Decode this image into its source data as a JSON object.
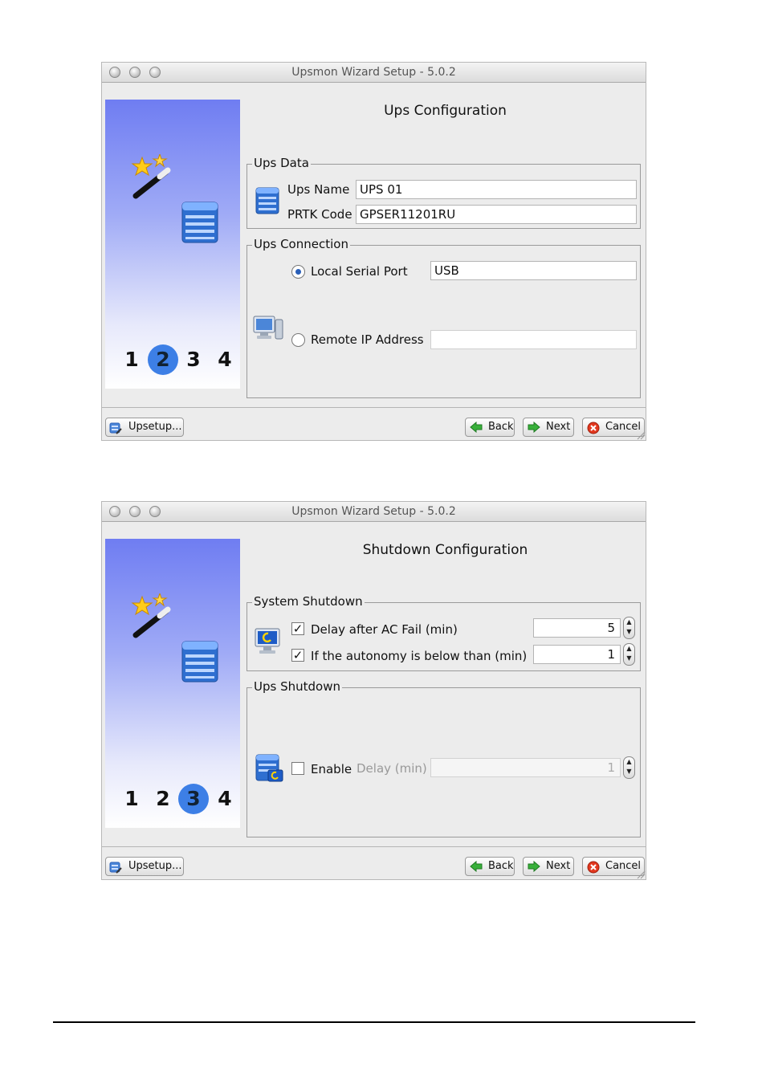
{
  "windows": [
    {
      "title": "Upsmon Wizard Setup - 5.0.2",
      "page_title": "Ups Configuration",
      "steps": [
        "1",
        "2",
        "3",
        "4"
      ],
      "active_step": "2",
      "ups_data": {
        "legend": "Ups Data",
        "name_label": "Ups Name",
        "name_value": "UPS 01",
        "prtk_label": "PRTK Code",
        "prtk_value": "GPSER11201RU"
      },
      "ups_connection": {
        "legend": "Ups Connection",
        "local_label": "Local Serial Port",
        "local_value": "USB",
        "local_selected": true,
        "remote_label": "Remote IP Address",
        "remote_value": "",
        "remote_selected": false
      },
      "buttons": {
        "upsetup": "Upsetup...",
        "back": "Back",
        "next": "Next",
        "cancel": "Cancel"
      }
    },
    {
      "title": "Upsmon Wizard Setup - 5.0.2",
      "page_title": "Shutdown Configuration",
      "steps": [
        "1",
        "2",
        "3",
        "4"
      ],
      "active_step": "3",
      "system_shutdown": {
        "legend": "System Shutdown",
        "delay_label": "Delay after AC Fail (min)",
        "delay_checked": true,
        "delay_value": "5",
        "autonomy_label": "If the autonomy is below than (min)",
        "autonomy_checked": true,
        "autonomy_value": "1"
      },
      "ups_shutdown": {
        "legend": "Ups Shutdown",
        "enable_label": "Enable",
        "enable_checked": false,
        "delay_label": "Delay (min)",
        "delay_value": "1"
      },
      "buttons": {
        "upsetup": "Upsetup...",
        "back": "Back",
        "next": "Next",
        "cancel": "Cancel"
      }
    }
  ],
  "colors": {
    "step_active": "#3d7fe6",
    "panel_top": "#6f7df2",
    "window_bg": "#ececec"
  }
}
